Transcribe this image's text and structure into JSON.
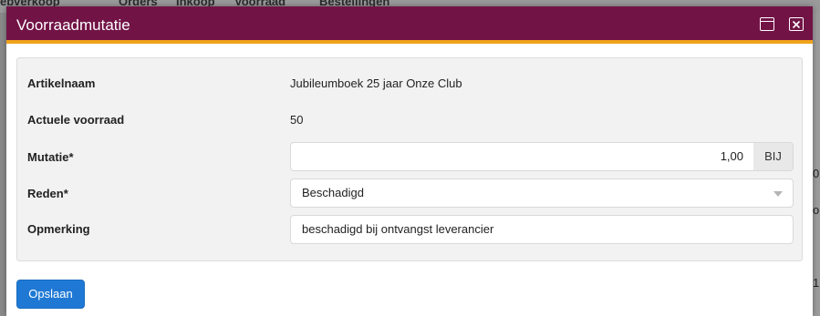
{
  "background": {
    "nav_items": [
      "ebverkoop",
      "Orders",
      "Inkoop",
      "Voorraad",
      "Bestellingen"
    ],
    "right_edge": [
      "0",
      "o",
      "1"
    ]
  },
  "dialog": {
    "title": "Voorraadmutatie",
    "buttons": {
      "maximize": "maximize-icon",
      "close": "close-icon"
    },
    "accent_colors": {
      "titlebar": "#721346",
      "stripe": "#f0a21c",
      "primary": "#1f79d4"
    }
  },
  "form": {
    "artikelnaam": {
      "label": "Artikelnaam",
      "value": "Jubileumboek 25 jaar Onze Club"
    },
    "actuele_voorraad": {
      "label": "Actuele voorraad",
      "value": "50"
    },
    "mutatie": {
      "label": "Mutatie*",
      "value": "1,00",
      "addon": "BIJ"
    },
    "reden": {
      "label": "Reden*",
      "selected": "Beschadigd"
    },
    "opmerking": {
      "label": "Opmerking",
      "value": "beschadigd bij ontvangst leverancier"
    }
  },
  "actions": {
    "save_label": "Opslaan"
  }
}
